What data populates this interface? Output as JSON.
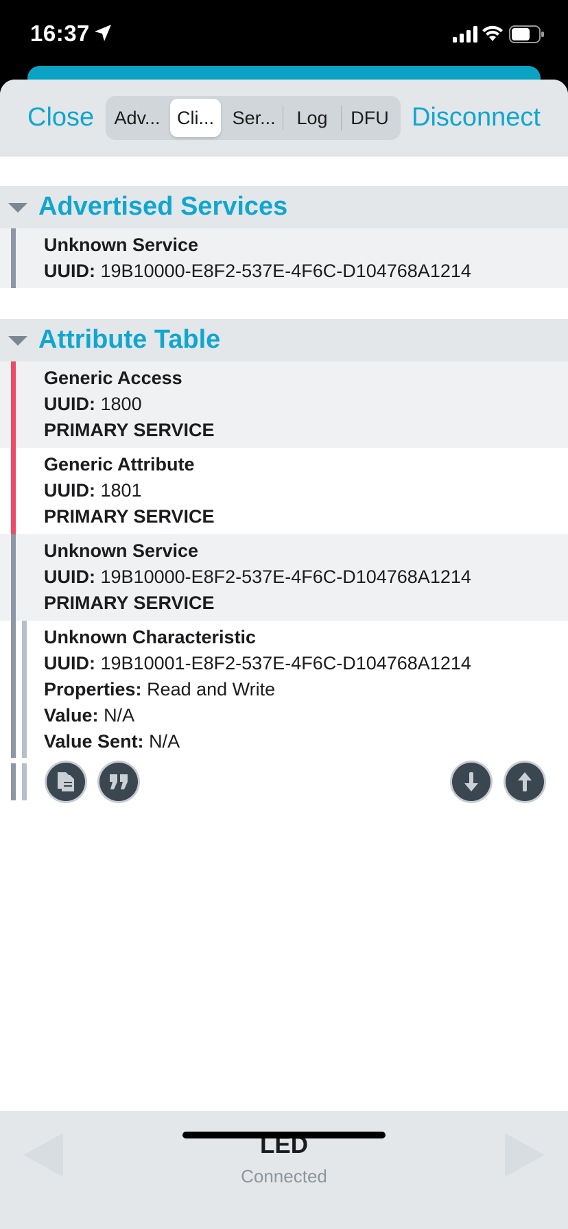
{
  "status": {
    "time": "16:37"
  },
  "nav": {
    "close_label": "Close",
    "disconnect_label": "Disconnect",
    "tabs": [
      {
        "label": "Adv..."
      },
      {
        "label": "Cli...",
        "selected": true
      },
      {
        "label": "Ser..."
      },
      {
        "label": "Log"
      },
      {
        "label": "DFU"
      }
    ]
  },
  "advertised": {
    "title": "Advertised Services",
    "items": [
      {
        "name": "Unknown Service",
        "uuid_label": "UUID:",
        "uuid": "19B10000-E8F2-537E-4F6C-D104768A1214"
      }
    ]
  },
  "attributes": {
    "title": "Attribute Table",
    "items": [
      {
        "name": "Generic Access",
        "uuid_label": "UUID:",
        "uuid": "1800",
        "type": "PRIMARY SERVICE"
      },
      {
        "name": "Generic Attribute",
        "uuid_label": "UUID:",
        "uuid": "1801",
        "type": "PRIMARY SERVICE"
      },
      {
        "name": "Unknown Service",
        "uuid_label": "UUID:",
        "uuid": "19B10000-E8F2-537E-4F6C-D104768A1214",
        "type": "PRIMARY SERVICE"
      }
    ],
    "characteristic": {
      "name": "Unknown Characteristic",
      "uuid_label": "UUID:",
      "uuid": "19B10001-E8F2-537E-4F6C-D104768A1214",
      "properties_label": "Properties:",
      "properties": "Read and Write",
      "value_label": "Value:",
      "value": "N/A",
      "value_sent_label": "Value Sent:",
      "value_sent": "N/A"
    }
  },
  "footer": {
    "device_name": "LED",
    "status": "Connected"
  },
  "colors": {
    "accent": "#11a6cf",
    "service_bar_red": "#ef4a68",
    "service_bar_gray": "#8c98a3"
  }
}
